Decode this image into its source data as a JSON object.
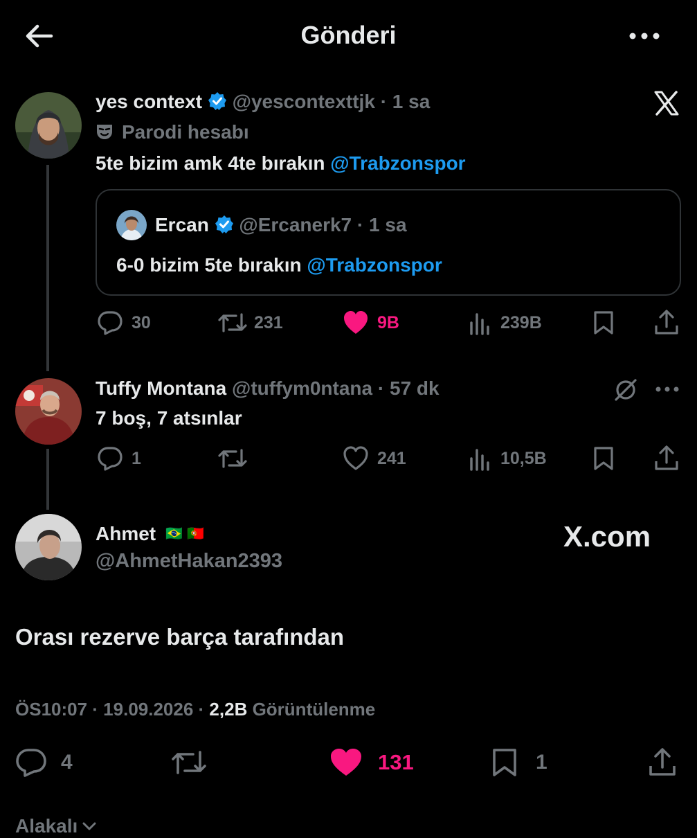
{
  "header": {
    "title": "Gönderi"
  },
  "tweet1": {
    "name": "yes context",
    "handle": "@yescontexttjk",
    "time": "· 1 sa",
    "parody_label": "Parodi hesabı",
    "text": "5te bizim amk 4te bırakın",
    "mention": "@Trabzonspor",
    "quote": {
      "name": "Ercan",
      "handle": "@Ercanerk7",
      "time": "· 1 sa",
      "text": "6-0 bizim 5te bırakın",
      "mention": "@Trabzonspor"
    },
    "stats": {
      "replies": "30",
      "reposts": "231",
      "likes": "9B",
      "views": "239B"
    }
  },
  "tweet2": {
    "name": "Tuffy Montana",
    "handle": "@tuffym0ntana",
    "time": "· 57 dk",
    "text": "7 boş, 7 atsınlar",
    "stats": {
      "replies": "1",
      "reposts": "",
      "likes": "241",
      "views": "10,5B"
    }
  },
  "main": {
    "name": "Ahmet",
    "handle": "@AhmetHakan2393",
    "flags": [
      "🇧🇷",
      "🇵🇹"
    ],
    "watermark": "X.com",
    "text": "Orası rezerve barça tarafından",
    "meta_time": "ÖS10:07 · 19.09.2026 ·",
    "meta_views_count": "2,2B",
    "meta_views_label": "Görüntülenme",
    "stats": {
      "replies": "4",
      "likes": "131",
      "bookmarks": "1"
    }
  },
  "footer": {
    "related_label": "Alakalı"
  },
  "colors": {
    "bg": "#000000",
    "text": "#e7e9ea",
    "muted": "#71767b",
    "link": "#1d9bf0",
    "like": "#f91880",
    "verified": "#1d9bf0"
  }
}
